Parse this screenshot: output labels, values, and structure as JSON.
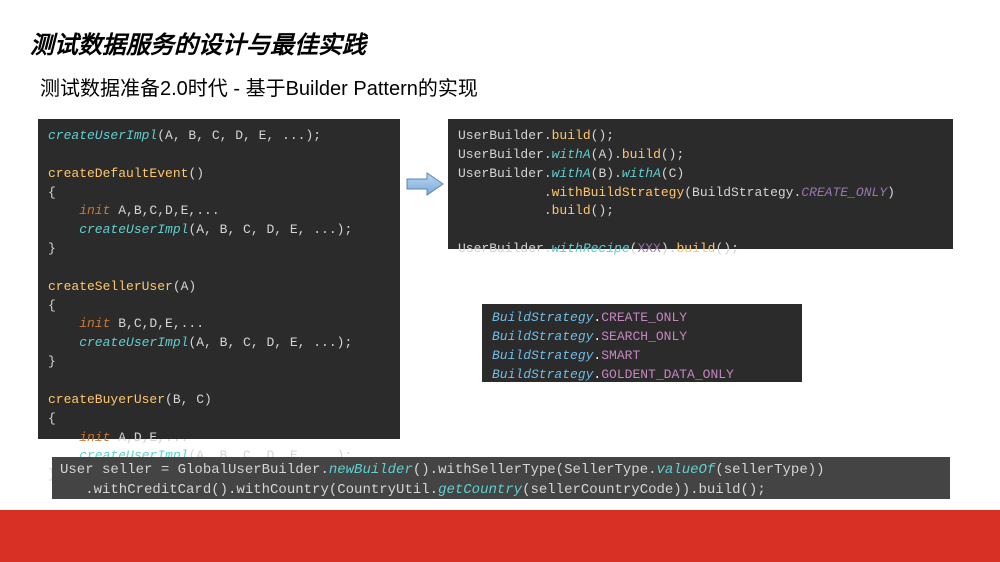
{
  "title": "测试数据服务的设计与最佳实践",
  "subtitle": "测试数据准备2.0时代 - 基于Builder Pattern的实现",
  "code_left": {
    "l1a": "createUserImpl",
    "l1b": "(A, B, C, D, E, ...);",
    "l2": "",
    "l3a": "createDefaultEvent",
    "l3b": "()",
    "l4": "{",
    "l5a": "    init ",
    "l5b": "A,B,C,D,E,...",
    "l6a": "    createUserImpl",
    "l6b": "(A, B, C, D, E, ...);",
    "l7": "}",
    "l8": "",
    "l9a": "createSellerUser",
    "l9b": "(A)",
    "l10": "{",
    "l11a": "    init ",
    "l11b": "B,C,D,E,...",
    "l12a": "    createUserImpl",
    "l12b": "(A, B, C, D, E, ...);",
    "l13": "}",
    "l14": "",
    "l15a": "createBuyerUser",
    "l15b": "(B, C)",
    "l16": "{",
    "l17a": "    init ",
    "l17b": "A,D,E,...",
    "l18a": "    createUserImpl",
    "l18b": "(A, B, C, D, E, ...);",
    "l19": "}"
  },
  "code_right_top": {
    "l1a": "UserBuilder.",
    "l1b": "build",
    "l1c": "();",
    "l2a": "UserBuilder.",
    "l2b": "withA",
    "l2c": "(A).",
    "l2d": "build",
    "l2e": "();",
    "l3a": "UserBuilder.",
    "l3b": "withA",
    "l3c": "(B).",
    "l3d": "withA",
    "l3e": "(C)",
    "l4a": "           .",
    "l4b": "withBuildStrategy",
    "l4c": "(BuildStrategy.",
    "l4d": "CREATE_ONLY",
    "l4e": ")",
    "l5a": "           .",
    "l5b": "build",
    "l5c": "();",
    "l6": "",
    "l7a": "UserBuilder.",
    "l7b": "withRecipe",
    "l7c": "(",
    "l7d": "XXX",
    "l7e": ").",
    "l7f": "build",
    "l7g": "();"
  },
  "code_right_mid": {
    "l1a": "BuildStrategy",
    "l1b": ".",
    "l1c": "CREATE_ONLY",
    "l2a": "BuildStrategy",
    "l2b": ".",
    "l2c": "SEARCH_ONLY",
    "l3a": "BuildStrategy",
    "l3b": ".",
    "l3c": "SMART",
    "l4a": "BuildStrategy",
    "l4b": ".",
    "l4c": "GOLDENT_DATA_ONLY"
  },
  "code_bottom": {
    "l1a": "User seller = GlobalUserBuilder.",
    "l1b": "newBuilder",
    "l1c": "().withSellerType(SellerType.",
    "l1d": "valueOf",
    "l1e": "(sellerType))",
    "l2a": "   .withCreditCard().withCountry(CountryUtil.",
    "l2b": "getCountry",
    "l2c": "(sellerCountryCode)).build();"
  }
}
